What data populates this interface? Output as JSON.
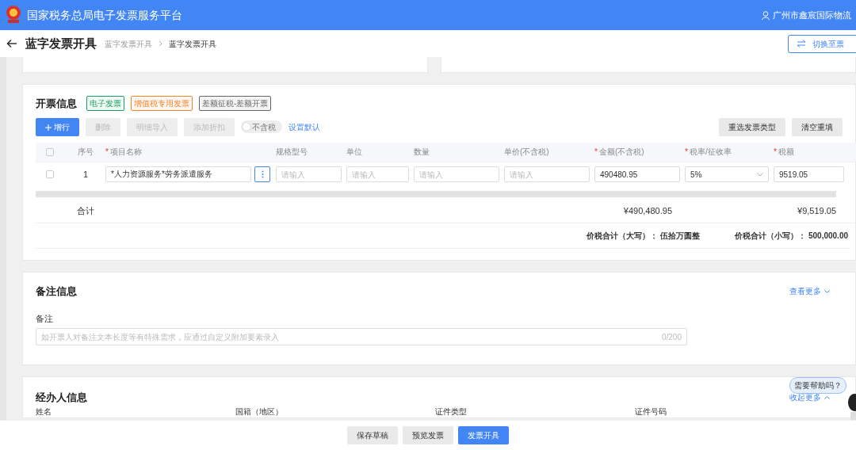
{
  "header": {
    "title": "国家税务总局电子发票服务平台",
    "user": "广州市鑫宸国际物流"
  },
  "page": {
    "title": "蓝字发票开具",
    "breadcrumb": [
      {
        "label": "蓝字发票开具",
        "selected": false
      },
      {
        "label": "蓝字发票开具",
        "selected": true
      }
    ],
    "switch_button": "切换至票"
  },
  "invoice": {
    "title": "开票信息",
    "tags": [
      {
        "label": "电子发票",
        "color": "#19a15f"
      },
      {
        "label": "增值税专用发票",
        "color": "#f5862a"
      },
      {
        "label": "差额征税-差额开票",
        "color": "#666666"
      }
    ],
    "toolbar": [
      {
        "label": "增行",
        "kind": "primary",
        "disabled": false
      },
      {
        "label": "删除",
        "kind": "plain",
        "disabled": true
      },
      {
        "label": "明细导入",
        "kind": "plain",
        "disabled": true
      },
      {
        "label": "添加折扣",
        "kind": "plain",
        "disabled": true
      }
    ],
    "tax_toggle": {
      "label": "不含税",
      "on": false
    },
    "default_link": "设置默认",
    "right_buttons": [
      "重选发票类型",
      "清空重填"
    ],
    "required_mark": "*",
    "select_all": {
      "checked": false
    },
    "columns": [
      {
        "label": "序号",
        "required": false
      },
      {
        "label": "项目名称",
        "required": true
      },
      {
        "label": "规格型号",
        "required": false
      },
      {
        "label": "单位",
        "required": false
      },
      {
        "label": "数量",
        "required": false
      },
      {
        "label": "单价(不含税)",
        "required": false
      },
      {
        "label": "金额(不含税)",
        "required": true
      },
      {
        "label": "税率/征收率",
        "required": true
      },
      {
        "label": "税额",
        "required": true
      }
    ],
    "rows": [
      {
        "checked": false,
        "cells": [
          {
            "kind": "text",
            "value": "1"
          },
          {
            "kind": "item",
            "value": "*人力资源服务*劳务派遣服务"
          },
          {
            "kind": "input",
            "placeholder": "请输入"
          },
          {
            "kind": "input",
            "placeholder": "请输入"
          },
          {
            "kind": "input",
            "placeholder": "请输入"
          },
          {
            "kind": "input",
            "placeholder": "请输入"
          },
          {
            "kind": "input",
            "value": "490480.95"
          },
          {
            "kind": "select",
            "value": "5%"
          },
          {
            "kind": "input",
            "value": "9519.05"
          }
        ]
      }
    ],
    "total": {
      "label": "合计",
      "amount": "¥490,480.95",
      "tax": "¥9,519.05"
    },
    "summary": [
      {
        "label": "价税合计（大写）：",
        "value": "伍拾万圆整"
      },
      {
        "label": "价税合计（小写）：",
        "value": "500,000.00"
      }
    ]
  },
  "remark": {
    "title": "备注信息",
    "more": "查看更多",
    "label": "备注",
    "placeholder": "如开票人对备注文本长度等有特殊需求，应通过自定义附加要素录入",
    "counter": "0/200"
  },
  "handler": {
    "title": "经办人信息",
    "more": "收起更多",
    "fields": [
      "姓名",
      "国籍（地区）",
      "证件类型",
      "证件号码"
    ]
  },
  "help": "需要帮助吗？",
  "footer": [
    {
      "label": "保存草稿",
      "kind": "plain"
    },
    {
      "label": "预览发票",
      "kind": "plain"
    },
    {
      "label": "发票开具",
      "kind": "primary"
    }
  ]
}
